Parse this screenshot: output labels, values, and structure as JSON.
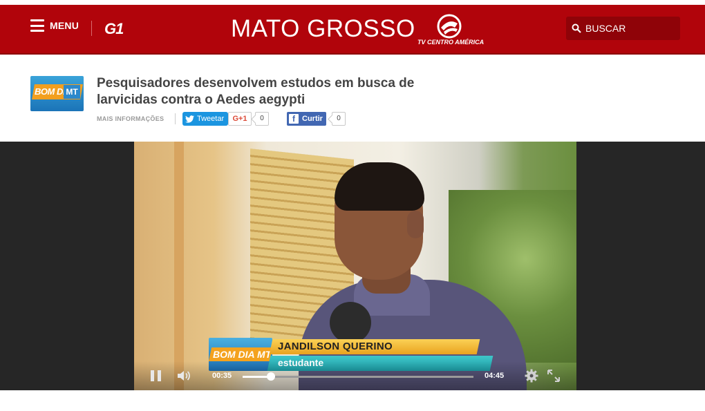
{
  "header": {
    "menu_label": "MENU",
    "logo_text": "G1",
    "site_title": "MATO GROSSO",
    "tv_logo_text": "TV CENTRO AMÉRICA",
    "search_placeholder": "BUSCAR",
    "bar_color": "#b1040b"
  },
  "article": {
    "thumbnail_text": "BOM DIA",
    "thumbnail_badge": "MT",
    "headline": "Pesquisadores desenvolvem estudos em busca de larvicidas contra o Aedes aegypti",
    "more_info_label": "MAIS INFORMAÇÕES",
    "tweet_label": "Tweetar",
    "gplus_label": "G+1",
    "gplus_count": "0",
    "like_label": "Curtir",
    "like_count": "0"
  },
  "video": {
    "lower_third_logo": "BOM DIA",
    "lower_third_logo_badge": "MT",
    "person_name": "JANDILSON QUERINO",
    "person_role": "estudante",
    "current_time": "00:35",
    "duration": "04:45",
    "progress_fraction": 0.123
  }
}
